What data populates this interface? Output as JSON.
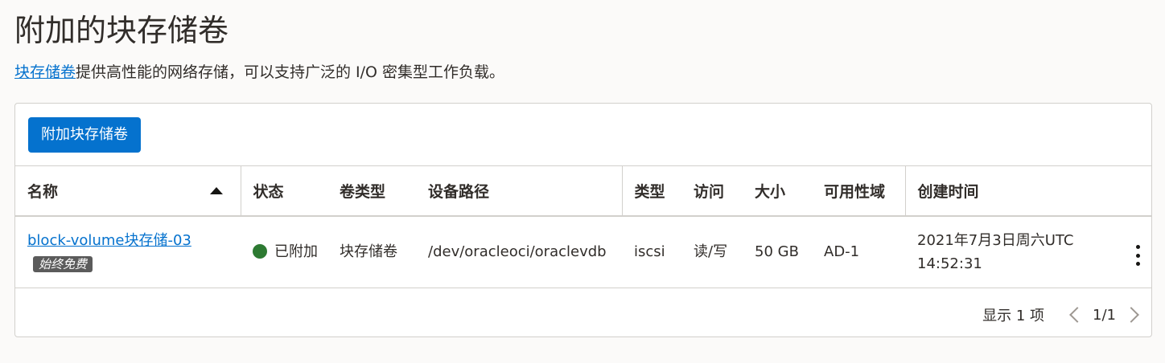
{
  "page": {
    "title": "附加的块存储卷",
    "desc_link": "块存储卷",
    "desc_text": "提供高性能的网络存储，可以支持广泛的 I/O 密集型工作负载。"
  },
  "toolbar": {
    "attach_label": "附加块存储卷"
  },
  "table": {
    "columns": [
      "名称",
      "状态",
      "卷类型",
      "设备路径",
      "类型",
      "访问",
      "大小",
      "可用性域",
      "创建时间"
    ],
    "sort": {
      "column": "名称",
      "direction": "ascending"
    },
    "rows": [
      {
        "name": "block-volume块存储-03",
        "tag": "始终免费",
        "status": "已附加",
        "volume_type": "块存储卷",
        "device_path": "/dev/oracleoci/oraclevdb",
        "type": "iscsi",
        "access": "读/写",
        "size": "50 GB",
        "availability_domain": "AD-1",
        "created": "2021年7月3日周六UTC 14:52:31"
      }
    ]
  },
  "pager": {
    "count_text": "显示 1 项",
    "page_text": "1/1"
  },
  "colors": {
    "accent": "#0572ce",
    "status_ok": "#2d7a32",
    "tag_bg": "#5b5b5b"
  },
  "icons": [
    "sort-ascending-icon",
    "status-dot-icon",
    "kebab-menu-icon",
    "chevron-left-icon",
    "chevron-right-icon"
  ]
}
